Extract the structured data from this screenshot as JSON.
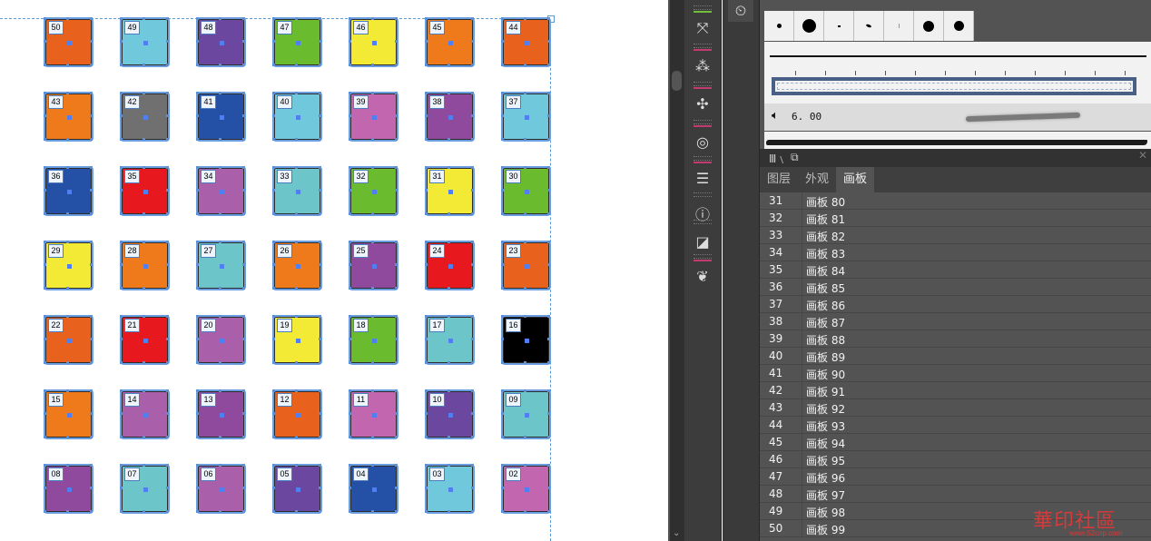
{
  "colors": {
    "orange": "#ee7a1c",
    "dark_orange": "#e8621e",
    "light_blue": "#6fc8dc",
    "teal": "#6cc6c9",
    "purple": "#6b47a0",
    "violet": "#8f4a9e",
    "pink": "#c266b0",
    "mauve": "#a95fa9",
    "green": "#6bbb2e",
    "yellow": "#f2ea34",
    "red": "#e8181f",
    "gray": "#707070",
    "blue": "#2450a6",
    "black": "#000000"
  },
  "artboards": [
    {
      "label": "50",
      "color": "dark_orange"
    },
    {
      "label": "49",
      "color": "light_blue"
    },
    {
      "label": "48",
      "color": "purple"
    },
    {
      "label": "47",
      "color": "green"
    },
    {
      "label": "46",
      "color": "yellow"
    },
    {
      "label": "45",
      "color": "orange"
    },
    {
      "label": "44",
      "color": "dark_orange"
    },
    {
      "label": "43",
      "color": "orange"
    },
    {
      "label": "42",
      "color": "gray"
    },
    {
      "label": "41",
      "color": "blue"
    },
    {
      "label": "40",
      "color": "light_blue"
    },
    {
      "label": "39",
      "color": "pink"
    },
    {
      "label": "38",
      "color": "violet"
    },
    {
      "label": "37",
      "color": "light_blue"
    },
    {
      "label": "36",
      "color": "blue"
    },
    {
      "label": "35",
      "color": "red"
    },
    {
      "label": "34",
      "color": "mauve"
    },
    {
      "label": "33",
      "color": "teal"
    },
    {
      "label": "32",
      "color": "green"
    },
    {
      "label": "31",
      "color": "yellow"
    },
    {
      "label": "30",
      "color": "green"
    },
    {
      "label": "29",
      "color": "yellow"
    },
    {
      "label": "28",
      "color": "orange"
    },
    {
      "label": "27",
      "color": "teal"
    },
    {
      "label": "26",
      "color": "orange"
    },
    {
      "label": "25",
      "color": "violet"
    },
    {
      "label": "24",
      "color": "red"
    },
    {
      "label": "23",
      "color": "dark_orange"
    },
    {
      "label": "22",
      "color": "dark_orange"
    },
    {
      "label": "21",
      "color": "red"
    },
    {
      "label": "20",
      "color": "mauve"
    },
    {
      "label": "19",
      "color": "yellow"
    },
    {
      "label": "18",
      "color": "green"
    },
    {
      "label": "17",
      "color": "teal"
    },
    {
      "label": "16",
      "color": "black"
    },
    {
      "label": "15",
      "color": "orange"
    },
    {
      "label": "14",
      "color": "mauve"
    },
    {
      "label": "13",
      "color": "violet"
    },
    {
      "label": "12",
      "color": "dark_orange"
    },
    {
      "label": "11",
      "color": "pink"
    },
    {
      "label": "10",
      "color": "purple"
    },
    {
      "label": "09",
      "color": "teal"
    },
    {
      "label": "08",
      "color": "violet"
    },
    {
      "label": "07",
      "color": "teal"
    },
    {
      "label": "06",
      "color": "mauve"
    },
    {
      "label": "05",
      "color": "purple"
    },
    {
      "label": "04",
      "color": "blue"
    },
    {
      "label": "03",
      "color": "light_blue"
    },
    {
      "label": "02",
      "color": "pink"
    }
  ],
  "tools": [
    "free-transform-icon",
    "symbol-sprayer-icon",
    "puppet-warp-icon",
    "spiral-icon",
    "align-lines-icon",
    "file-info-icon",
    "image-trace-icon",
    "butterfly-symbol-icon"
  ],
  "clock_icon": "clock-icon",
  "brushes": {
    "calligraphic_value": "6. 00"
  },
  "panel_bar": {
    "libraries_icon": "libraries-icon",
    "cc-icon": "cc-libraries-icon",
    "close_glyph": "✕"
  },
  "tabs": [
    {
      "label": "图层",
      "active": false
    },
    {
      "label": "外观",
      "active": false
    },
    {
      "label": "画板",
      "active": true
    }
  ],
  "artboard_list": [
    {
      "num": "31",
      "name": "画板 80"
    },
    {
      "num": "32",
      "name": "画板 81"
    },
    {
      "num": "33",
      "name": "画板 82"
    },
    {
      "num": "34",
      "name": "画板 83"
    },
    {
      "num": "35",
      "name": "画板 84"
    },
    {
      "num": "36",
      "name": "画板 85"
    },
    {
      "num": "37",
      "name": "画板 86"
    },
    {
      "num": "38",
      "name": "画板 87"
    },
    {
      "num": "39",
      "name": "画板 88"
    },
    {
      "num": "40",
      "name": "画板 89"
    },
    {
      "num": "41",
      "name": "画板 90"
    },
    {
      "num": "42",
      "name": "画板 91"
    },
    {
      "num": "43",
      "name": "画板 92"
    },
    {
      "num": "44",
      "name": "画板 93"
    },
    {
      "num": "45",
      "name": "画板 94"
    },
    {
      "num": "46",
      "name": "画板 95"
    },
    {
      "num": "47",
      "name": "画板 96"
    },
    {
      "num": "48",
      "name": "画板 97"
    },
    {
      "num": "49",
      "name": "画板 98"
    },
    {
      "num": "50",
      "name": "画板 99"
    }
  ],
  "watermark": {
    "text": "華印社區",
    "url": "www.52cnp.com"
  }
}
